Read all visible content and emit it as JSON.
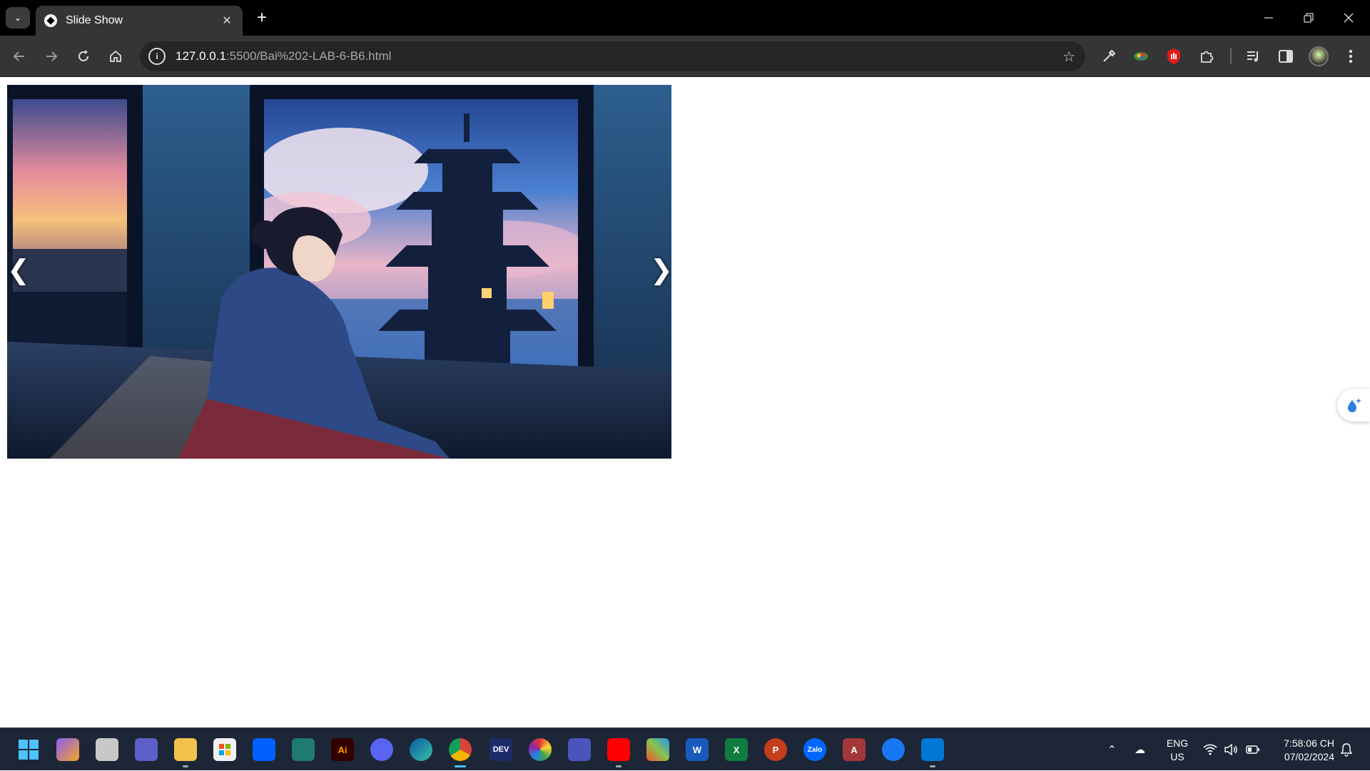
{
  "browser": {
    "tab_title": "Slide Show",
    "url_host": "127.0.0.1",
    "url_rest": ":5500/Bai%202-LAB-6-B6.html",
    "tab_list_icon": "chevron-down-icon",
    "new_tab_icon": "plus-icon",
    "window_controls": [
      "minimize-icon",
      "restore-icon",
      "close-icon"
    ]
  },
  "toolbar": {
    "nav_icons": [
      "back-arrow-icon",
      "forward-arrow-icon",
      "reload-icon",
      "home-icon"
    ],
    "extension_icons": [
      "eyedropper-icon",
      "color-extension-icon",
      "adblock-icon",
      "puzzle-icon",
      "media-icon",
      "sidepanel-icon",
      "profile-avatar-icon",
      "more-menu-icon"
    ]
  },
  "slideshow": {
    "prev_label": "❮",
    "next_label": "❯"
  },
  "taskbar": {
    "apps": [
      "windows-start",
      "premiere-pro",
      "file-manager",
      "teams",
      "file-explorer",
      "microsoft-store",
      "dropbox",
      "vs-code-insiders",
      "adobe-illustrator",
      "discord",
      "edge",
      "chrome",
      "dev-tool",
      "color-app",
      "teams-classic",
      "youtube",
      "git",
      "word",
      "excel",
      "powerpoint",
      "zalo",
      "access",
      "facebook",
      "vs-code"
    ],
    "illustrator_label": "Ai",
    "word_label": "W",
    "excel_label": "X",
    "powerpoint_label": "P",
    "access_label": "A",
    "zalo_label": "Zalo",
    "dev_label": "DEV",
    "language_line1": "ENG",
    "language_line2": "US",
    "time": "7:58:06 CH",
    "date": "07/02/2024"
  },
  "colors": {
    "titlebar": "#000000",
    "toolbar": "#353535",
    "taskbar": "#1c2636",
    "accent": "#4cc2ff"
  }
}
